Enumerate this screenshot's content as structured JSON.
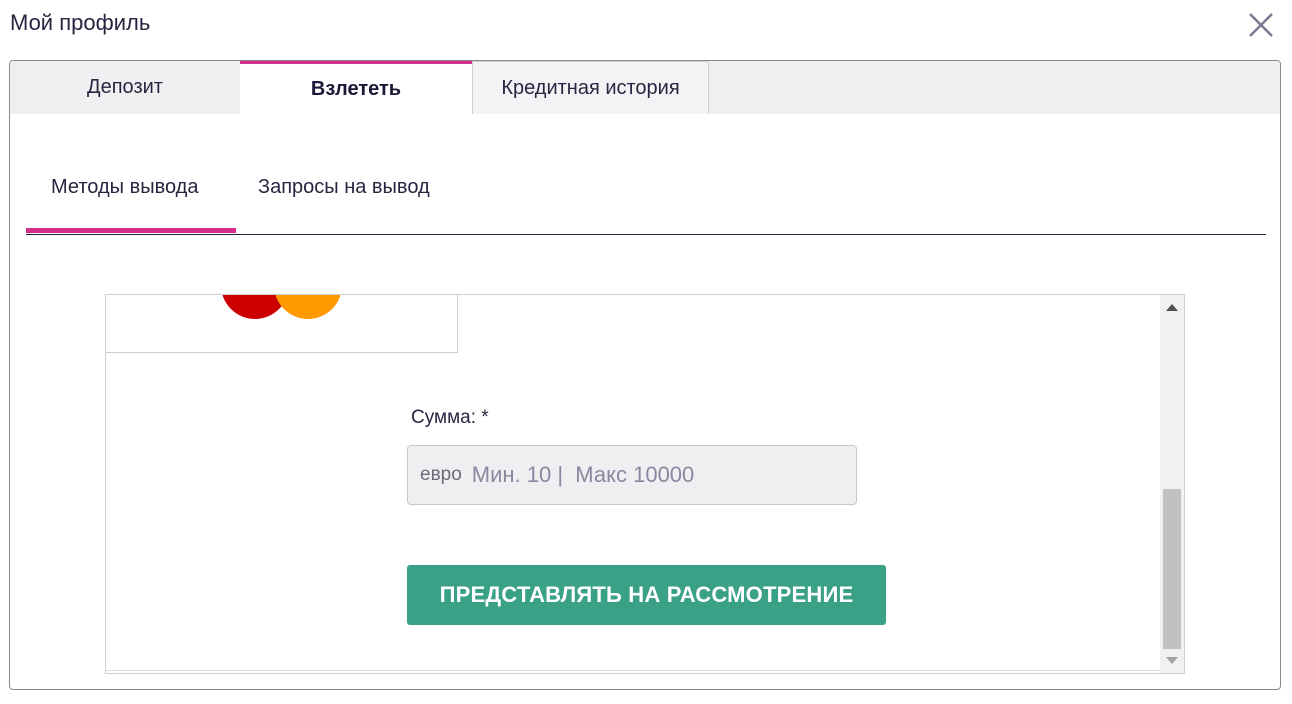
{
  "window": {
    "title": "Мой профиль"
  },
  "tabs": [
    {
      "label": "Депозит"
    },
    {
      "label": "Взлететь"
    },
    {
      "label": "Кредитная история"
    }
  ],
  "subtabs": [
    {
      "label": "Методы вывода"
    },
    {
      "label": "Запросы на вывод"
    }
  ],
  "form": {
    "amount_label": "Сумма: *",
    "currency": "евро",
    "placeholder": "Мин. 10 |  Макс 10000",
    "submit_label": "ПРЕДСТАВЛЯТЬ НА РАССМОТРЕНИЕ"
  },
  "colors": {
    "accent": "#d42e8a",
    "submit": "#3aa187",
    "mastercard_red": "#cc0000",
    "mastercard_orange": "#ff9900"
  }
}
